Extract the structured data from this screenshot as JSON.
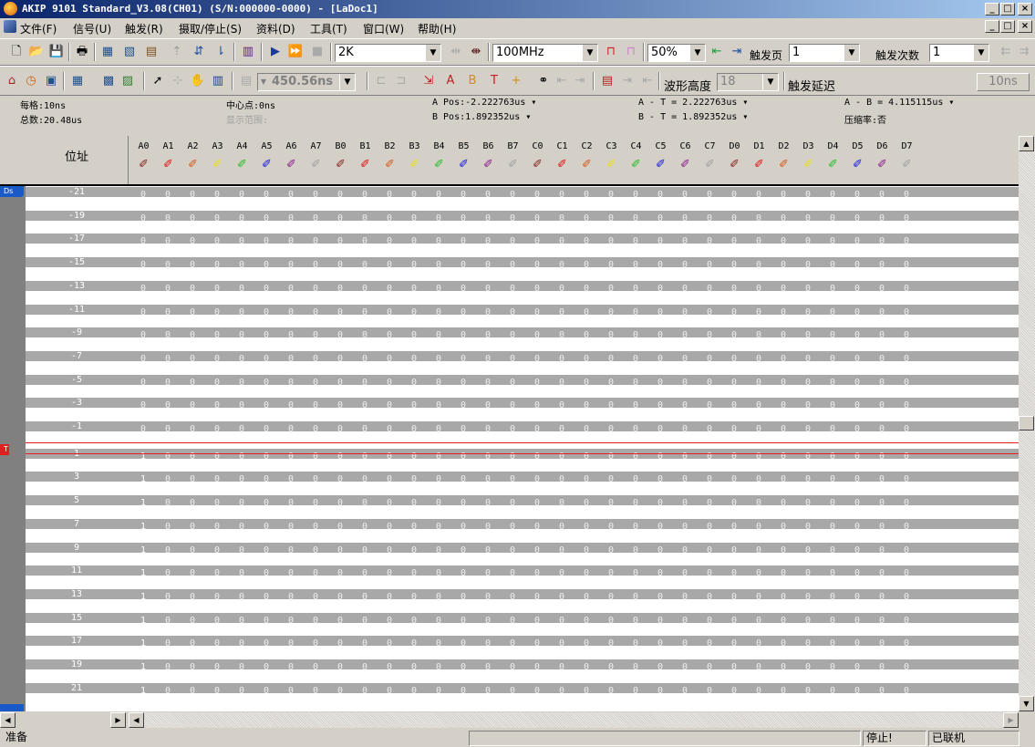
{
  "title": "AKIP 9101 Standard_V3.08(CH01) (S/N:000000-0000) - [LaDoc1]",
  "window_buttons": {
    "minimize": "_",
    "maximize": "□",
    "close": "×"
  },
  "menu": [
    "文件(F)",
    "信号(U)",
    "触发(R)",
    "摄取/停止(S)",
    "资料(D)",
    "工具(T)",
    "窗口(W)",
    "帮助(H)"
  ],
  "toolbar1": {
    "memory_depth": "2K",
    "sample_rate": "100MHz",
    "trigger_position": "50%",
    "trigger_page_label": "触发页",
    "trigger_page_value": "1",
    "trigger_count_label": "触发次数",
    "trigger_count_value": "1"
  },
  "toolbar2": {
    "time_value": "450.56ns",
    "waveform_height_label": "波形高度",
    "waveform_height_value": "18",
    "trigger_delay_label": "触发延迟",
    "trigger_delay_value": "10ns"
  },
  "info": {
    "per_div": "每格:10ns",
    "total": "总数:20.48us",
    "center": "中心点:0ns",
    "display_range": "显示范围:",
    "a_pos": "A Pos:-2.222763us",
    "b_pos": "B Pos:1.892352us",
    "a_t": "A - T = 2.222763us",
    "b_t": "B - T = 1.892352us",
    "a_b": "A - B = 4.115115us",
    "compression": "压缩率:否"
  },
  "grid": {
    "address_header": "位址",
    "markers": {
      "ds": "Ds",
      "trigger": "T"
    },
    "channels": [
      "A0",
      "A1",
      "A2",
      "A3",
      "A4",
      "A5",
      "A6",
      "A7",
      "B0",
      "B1",
      "B2",
      "B3",
      "B4",
      "B5",
      "B6",
      "B7",
      "C0",
      "C1",
      "C2",
      "C3",
      "C4",
      "C5",
      "C6",
      "C7",
      "D0",
      "D1",
      "D2",
      "D3",
      "D4",
      "D5",
      "D6",
      "D7"
    ],
    "channel_colors": [
      "#8b1a1a",
      "#e01010",
      "#d05a1a",
      "#e8e020",
      "#20c020",
      "#1010e0",
      "#8a1a8a",
      "#a0a0a0"
    ],
    "rows": [
      {
        "addr": "-21",
        "bits": [
          "0",
          "0",
          "0",
          "0",
          "0",
          "0",
          "0",
          "0",
          "0",
          "0",
          "0",
          "0",
          "0",
          "0",
          "0",
          "0",
          "0",
          "0",
          "0",
          "0",
          "0",
          "0",
          "0",
          "0",
          "0",
          "0",
          "0",
          "0",
          "0",
          "0",
          "0",
          "0"
        ]
      },
      {
        "addr": "-19",
        "bits": [
          "0",
          "0",
          "0",
          "0",
          "0",
          "0",
          "0",
          "0",
          "0",
          "0",
          "0",
          "0",
          "0",
          "0",
          "0",
          "0",
          "0",
          "0",
          "0",
          "0",
          "0",
          "0",
          "0",
          "0",
          "0",
          "0",
          "0",
          "0",
          "0",
          "0",
          "0",
          "0"
        ]
      },
      {
        "addr": "-17",
        "bits": [
          "0",
          "0",
          "0",
          "0",
          "0",
          "0",
          "0",
          "0",
          "0",
          "0",
          "0",
          "0",
          "0",
          "0",
          "0",
          "0",
          "0",
          "0",
          "0",
          "0",
          "0",
          "0",
          "0",
          "0",
          "0",
          "0",
          "0",
          "0",
          "0",
          "0",
          "0",
          "0"
        ]
      },
      {
        "addr": "-15",
        "bits": [
          "0",
          "0",
          "0",
          "0",
          "0",
          "0",
          "0",
          "0",
          "0",
          "0",
          "0",
          "0",
          "0",
          "0",
          "0",
          "0",
          "0",
          "0",
          "0",
          "0",
          "0",
          "0",
          "0",
          "0",
          "0",
          "0",
          "0",
          "0",
          "0",
          "0",
          "0",
          "0"
        ]
      },
      {
        "addr": "-13",
        "bits": [
          "0",
          "0",
          "0",
          "0",
          "0",
          "0",
          "0",
          "0",
          "0",
          "0",
          "0",
          "0",
          "0",
          "0",
          "0",
          "0",
          "0",
          "0",
          "0",
          "0",
          "0",
          "0",
          "0",
          "0",
          "0",
          "0",
          "0",
          "0",
          "0",
          "0",
          "0",
          "0"
        ]
      },
      {
        "addr": "-11",
        "bits": [
          "0",
          "0",
          "0",
          "0",
          "0",
          "0",
          "0",
          "0",
          "0",
          "0",
          "0",
          "0",
          "0",
          "0",
          "0",
          "0",
          "0",
          "0",
          "0",
          "0",
          "0",
          "0",
          "0",
          "0",
          "0",
          "0",
          "0",
          "0",
          "0",
          "0",
          "0",
          "0"
        ]
      },
      {
        "addr": "-9",
        "bits": [
          "0",
          "0",
          "0",
          "0",
          "0",
          "0",
          "0",
          "0",
          "0",
          "0",
          "0",
          "0",
          "0",
          "0",
          "0",
          "0",
          "0",
          "0",
          "0",
          "0",
          "0",
          "0",
          "0",
          "0",
          "0",
          "0",
          "0",
          "0",
          "0",
          "0",
          "0",
          "0"
        ]
      },
      {
        "addr": "-7",
        "bits": [
          "0",
          "0",
          "0",
          "0",
          "0",
          "0",
          "0",
          "0",
          "0",
          "0",
          "0",
          "0",
          "0",
          "0",
          "0",
          "0",
          "0",
          "0",
          "0",
          "0",
          "0",
          "0",
          "0",
          "0",
          "0",
          "0",
          "0",
          "0",
          "0",
          "0",
          "0",
          "0"
        ]
      },
      {
        "addr": "-5",
        "bits": [
          "0",
          "0",
          "0",
          "0",
          "0",
          "0",
          "0",
          "0",
          "0",
          "0",
          "0",
          "0",
          "0",
          "0",
          "0",
          "0",
          "0",
          "0",
          "0",
          "0",
          "0",
          "0",
          "0",
          "0",
          "0",
          "0",
          "0",
          "0",
          "0",
          "0",
          "0",
          "0"
        ]
      },
      {
        "addr": "-3",
        "bits": [
          "0",
          "0",
          "0",
          "0",
          "0",
          "0",
          "0",
          "0",
          "0",
          "0",
          "0",
          "0",
          "0",
          "0",
          "0",
          "0",
          "0",
          "0",
          "0",
          "0",
          "0",
          "0",
          "0",
          "0",
          "0",
          "0",
          "0",
          "0",
          "0",
          "0",
          "0",
          "0"
        ]
      },
      {
        "addr": "-1",
        "bits": [
          "0",
          "0",
          "0",
          "0",
          "0",
          "0",
          "0",
          "0",
          "0",
          "0",
          "0",
          "0",
          "0",
          "0",
          "0",
          "0",
          "0",
          "0",
          "0",
          "0",
          "0",
          "0",
          "0",
          "0",
          "0",
          "0",
          "0",
          "0",
          "0",
          "0",
          "0",
          "0"
        ]
      },
      {
        "addr": "1",
        "bits": [
          "1",
          "0",
          "0",
          "0",
          "0",
          "0",
          "0",
          "0",
          "0",
          "0",
          "0",
          "0",
          "0",
          "0",
          "0",
          "0",
          "0",
          "0",
          "0",
          "0",
          "0",
          "0",
          "0",
          "0",
          "0",
          "0",
          "0",
          "0",
          "0",
          "0",
          "0",
          "0"
        ]
      },
      {
        "addr": "3",
        "bits": [
          "1",
          "0",
          "0",
          "0",
          "0",
          "0",
          "0",
          "0",
          "0",
          "0",
          "0",
          "0",
          "0",
          "0",
          "0",
          "0",
          "0",
          "0",
          "0",
          "0",
          "0",
          "0",
          "0",
          "0",
          "0",
          "0",
          "0",
          "0",
          "0",
          "0",
          "0",
          "0"
        ]
      },
      {
        "addr": "5",
        "bits": [
          "1",
          "0",
          "0",
          "0",
          "0",
          "0",
          "0",
          "0",
          "0",
          "0",
          "0",
          "0",
          "0",
          "0",
          "0",
          "0",
          "0",
          "0",
          "0",
          "0",
          "0",
          "0",
          "0",
          "0",
          "0",
          "0",
          "0",
          "0",
          "0",
          "0",
          "0",
          "0"
        ]
      },
      {
        "addr": "7",
        "bits": [
          "1",
          "0",
          "0",
          "0",
          "0",
          "0",
          "0",
          "0",
          "0",
          "0",
          "0",
          "0",
          "0",
          "0",
          "0",
          "0",
          "0",
          "0",
          "0",
          "0",
          "0",
          "0",
          "0",
          "0",
          "0",
          "0",
          "0",
          "0",
          "0",
          "0",
          "0",
          "0"
        ]
      },
      {
        "addr": "9",
        "bits": [
          "1",
          "0",
          "0",
          "0",
          "0",
          "0",
          "0",
          "0",
          "0",
          "0",
          "0",
          "0",
          "0",
          "0",
          "0",
          "0",
          "0",
          "0",
          "0",
          "0",
          "0",
          "0",
          "0",
          "0",
          "0",
          "0",
          "0",
          "0",
          "0",
          "0",
          "0",
          "0"
        ]
      },
      {
        "addr": "11",
        "bits": [
          "1",
          "0",
          "0",
          "0",
          "0",
          "0",
          "0",
          "0",
          "0",
          "0",
          "0",
          "0",
          "0",
          "0",
          "0",
          "0",
          "0",
          "0",
          "0",
          "0",
          "0",
          "0",
          "0",
          "0",
          "0",
          "0",
          "0",
          "0",
          "0",
          "0",
          "0",
          "0"
        ]
      },
      {
        "addr": "13",
        "bits": [
          "1",
          "0",
          "0",
          "0",
          "0",
          "0",
          "0",
          "0",
          "0",
          "0",
          "0",
          "0",
          "0",
          "0",
          "0",
          "0",
          "0",
          "0",
          "0",
          "0",
          "0",
          "0",
          "0",
          "0",
          "0",
          "0",
          "0",
          "0",
          "0",
          "0",
          "0",
          "0"
        ]
      },
      {
        "addr": "15",
        "bits": [
          "1",
          "0",
          "0",
          "0",
          "0",
          "0",
          "0",
          "0",
          "0",
          "0",
          "0",
          "0",
          "0",
          "0",
          "0",
          "0",
          "0",
          "0",
          "0",
          "0",
          "0",
          "0",
          "0",
          "0",
          "0",
          "0",
          "0",
          "0",
          "0",
          "0",
          "0",
          "0"
        ]
      },
      {
        "addr": "17",
        "bits": [
          "1",
          "0",
          "0",
          "0",
          "0",
          "0",
          "0",
          "0",
          "0",
          "0",
          "0",
          "0",
          "0",
          "0",
          "0",
          "0",
          "0",
          "0",
          "0",
          "0",
          "0",
          "0",
          "0",
          "0",
          "0",
          "0",
          "0",
          "0",
          "0",
          "0",
          "0",
          "0"
        ]
      },
      {
        "addr": "19",
        "bits": [
          "1",
          "0",
          "0",
          "0",
          "0",
          "0",
          "0",
          "0",
          "0",
          "0",
          "0",
          "0",
          "0",
          "0",
          "0",
          "0",
          "0",
          "0",
          "0",
          "0",
          "0",
          "0",
          "0",
          "0",
          "0",
          "0",
          "0",
          "0",
          "0",
          "0",
          "0",
          "0"
        ]
      },
      {
        "addr": "21",
        "bits": [
          "1",
          "0",
          "0",
          "0",
          "0",
          "0",
          "0",
          "0",
          "0",
          "0",
          "0",
          "0",
          "0",
          "0",
          "0",
          "0",
          "0",
          "0",
          "0",
          "0",
          "0",
          "0",
          "0",
          "0",
          "0",
          "0",
          "0",
          "0",
          "0",
          "0",
          "0",
          "0"
        ]
      }
    ]
  },
  "status": {
    "ready": "准备",
    "stopped": "停止!",
    "connected": "已联机"
  }
}
